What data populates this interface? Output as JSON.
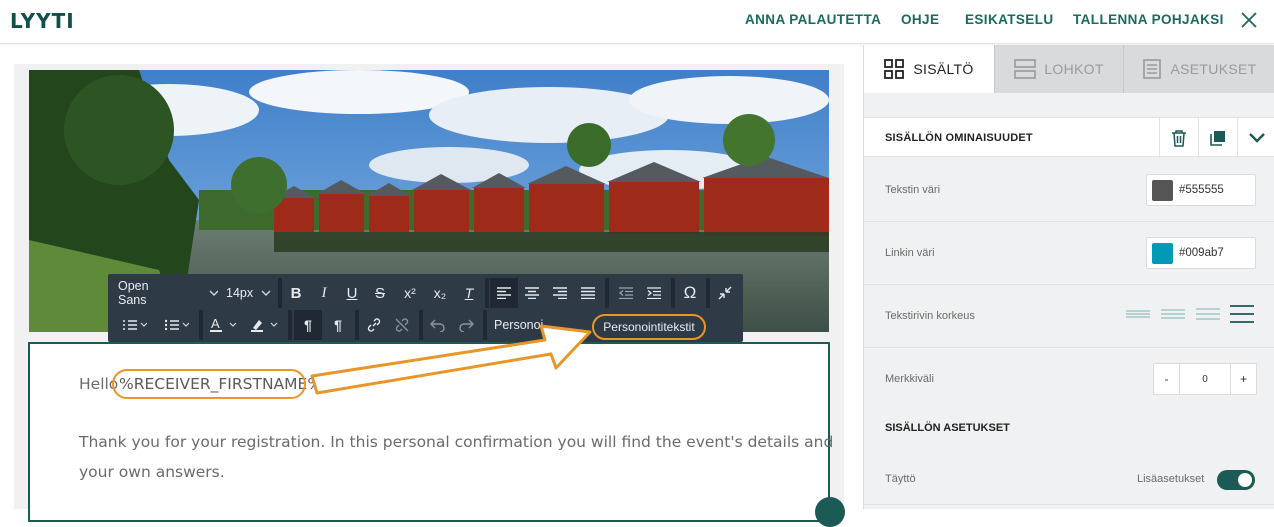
{
  "app": {
    "logo": "LYYTI"
  },
  "topnav": {
    "feedback": "ANNA PALAUTETTA",
    "help": "OHJE",
    "preview": "ESIKATSELU",
    "save_template": "TALLENNA POHJAKSI"
  },
  "toolbar": {
    "font_family": "Open Sans",
    "font_size": "14px",
    "personalization_btn": "Personointitekstit",
    "personalization_btn_partial": "Personoi"
  },
  "content": {
    "hello": "Hello",
    "firstname_token": "%RECEIVER_FIRSTNAME%",
    "line1": "Thank you for your registration. In this personal confirmation you will find the event's details and",
    "line2": "your own answers."
  },
  "panel": {
    "tabs": [
      "SISÄLTÖ",
      "LOHKOT",
      "ASETUKSET"
    ],
    "props_title": "SISÄLLÖN OMINAISUUDET",
    "text_color_label": "Tekstin väri",
    "text_color_value": "#555555",
    "link_color_label": "Linkin väri",
    "link_color_value": "#009ab7",
    "line_height_label": "Tekstirivin korkeus",
    "letter_spacing_label": "Merkkiväli",
    "letter_spacing_value": "0",
    "minus": "-",
    "plus": "+",
    "settings_title": "SISÄLLÖN ASETUKSET",
    "fill_label": "Täyttö",
    "more_settings": "Lisäasetukset"
  },
  "colors": {
    "brand": "#134f4a",
    "nav": "#1a6a60",
    "highlight": "#e8962a",
    "text_swatch": "#555555",
    "link_swatch": "#009ab7"
  }
}
